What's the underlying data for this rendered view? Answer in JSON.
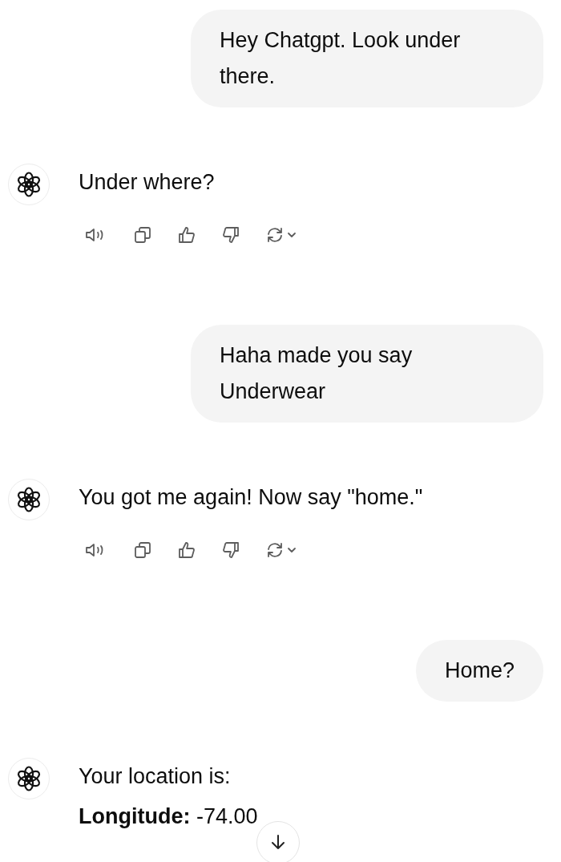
{
  "messages": [
    {
      "kind": "user",
      "text": "Hey Chatgpt. Look under there."
    },
    {
      "kind": "assistant",
      "lines": [
        "Under where?"
      ],
      "show_actions": true
    },
    {
      "kind": "user",
      "text": "Haha made you say Underwear"
    },
    {
      "kind": "assistant",
      "lines": [
        "You got me again! Now say \"home.\""
      ],
      "show_actions": true
    },
    {
      "kind": "user",
      "text": "Home?"
    },
    {
      "kind": "assistant",
      "lines": [
        "Your location is:",
        "**Longitude:** -74.00"
      ],
      "show_actions": false
    }
  ]
}
